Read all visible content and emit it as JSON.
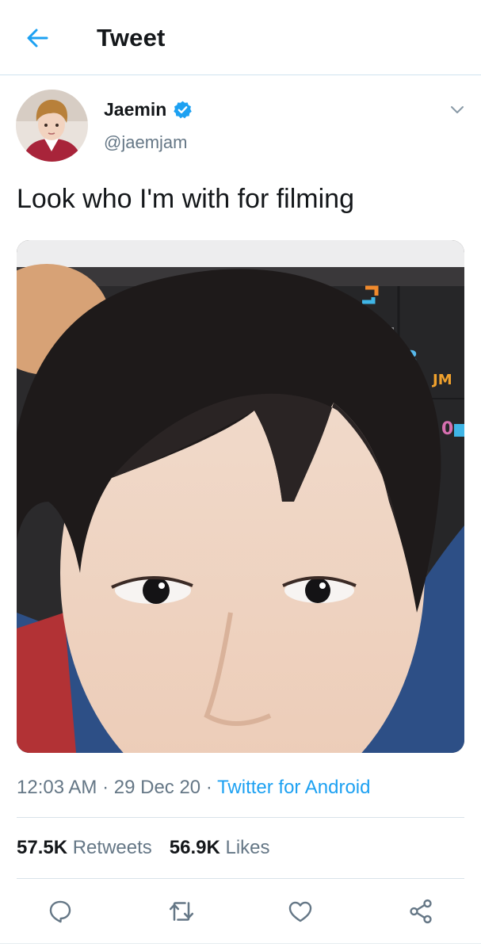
{
  "header": {
    "title": "Tweet",
    "back_icon": "arrow-left-icon"
  },
  "tweet": {
    "author": {
      "name": "Jaemin",
      "handle": "@jaemjam",
      "verified": true
    },
    "text": "Look who I'm with for filming",
    "media": {
      "type": "photo",
      "overlay_text": [
        "18",
        "JM",
        "0"
      ]
    },
    "meta": {
      "time": "12:03 AM",
      "separator": "·",
      "date": "29 Dec 20",
      "source": "Twitter for Android"
    },
    "stats": {
      "retweets_count": "57.5K",
      "retweets_label": "Retweets",
      "likes_count": "56.9K",
      "likes_label": "Likes"
    }
  },
  "actions": [
    "reply-icon",
    "retweet-icon",
    "like-icon",
    "share-icon"
  ],
  "colors": {
    "accent": "#1da1f2",
    "text": "#14171a",
    "secondary": "#657786",
    "divider": "#d8e2ea"
  }
}
